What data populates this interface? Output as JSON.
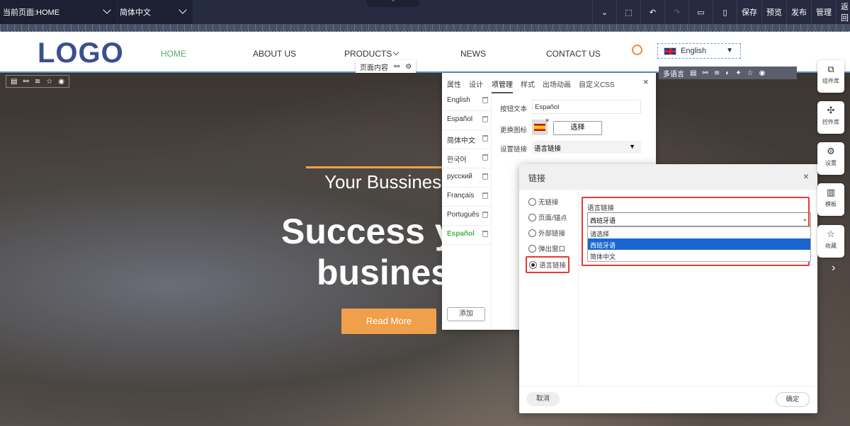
{
  "topbar": {
    "current_page": "当前页面:HOME",
    "language": "简体中文",
    "tools": [
      "保存",
      "预览",
      "发布",
      "管理",
      "返回"
    ]
  },
  "header": {
    "logo": "LOGO",
    "nav": [
      "HOME",
      "ABOUT US",
      "PRODUCTS",
      "NEWS",
      "CONTACT US"
    ],
    "lang_switch": "English"
  },
  "toolbars": {
    "page_content": "页面内容",
    "multilang": "多语言"
  },
  "hero": {
    "subtitle": "Your Bussines",
    "title1": "Success y",
    "title2": "busines",
    "button": "Read More"
  },
  "panel": {
    "tabs": [
      "属性",
      "设计",
      "项管理",
      "样式",
      "出场动画",
      "自定义CSS"
    ],
    "languages": [
      "English",
      "Español",
      "简体中文",
      "한국어",
      "русский",
      "Français",
      "Português",
      "Español"
    ],
    "add": "添加",
    "button_text_label": "按钮文本",
    "button_text_value": "Español",
    "icon_label": "更换图标",
    "choose": "选择",
    "link_label": "设置链接",
    "link_value": "语言链接"
  },
  "dialog": {
    "title": "链接",
    "options": [
      "无链接",
      "页面/锚点",
      "外部链接",
      "弹出窗口",
      "语言链接"
    ],
    "field_label": "语言链接",
    "selected": "西班牙语",
    "dropdown": [
      "请选择",
      "西班牙语",
      "简体中文"
    ],
    "cancel": "取消",
    "ok": "确定"
  },
  "sidebar": [
    "组件库",
    "控件库",
    "设置",
    "模板",
    "收藏"
  ],
  "colors": {
    "accent": "#f0a04b",
    "highlight": "#1a66d0",
    "red": "#e53935",
    "green": "#4caf50"
  }
}
